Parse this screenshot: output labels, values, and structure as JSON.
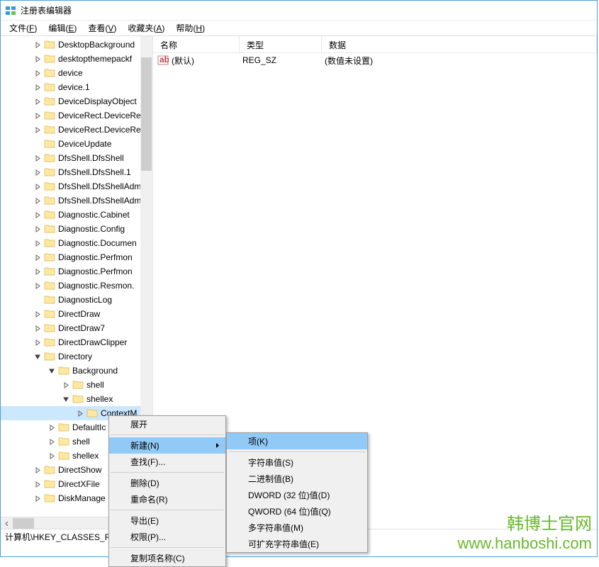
{
  "window": {
    "title": "注册表编辑器"
  },
  "menubar": [
    {
      "label": "文件",
      "accel": "F"
    },
    {
      "label": "编辑",
      "accel": "E"
    },
    {
      "label": "查看",
      "accel": "V"
    },
    {
      "label": "收藏夹",
      "accel": "A"
    },
    {
      "label": "帮助",
      "accel": "H"
    }
  ],
  "tree": [
    {
      "indent": 46,
      "exp": ">",
      "label": "DesktopBackground"
    },
    {
      "indent": 46,
      "exp": ">",
      "label": "desktopthemepackf"
    },
    {
      "indent": 46,
      "exp": ">",
      "label": "device"
    },
    {
      "indent": 46,
      "exp": ">",
      "label": "device.1"
    },
    {
      "indent": 46,
      "exp": ">",
      "label": "DeviceDisplayObject"
    },
    {
      "indent": 46,
      "exp": ">",
      "label": "DeviceRect.DeviceRe"
    },
    {
      "indent": 46,
      "exp": ">",
      "label": "DeviceRect.DeviceRe"
    },
    {
      "indent": 46,
      "exp": "",
      "label": "DeviceUpdate"
    },
    {
      "indent": 46,
      "exp": ">",
      "label": "DfsShell.DfsShell"
    },
    {
      "indent": 46,
      "exp": ">",
      "label": "DfsShell.DfsShell.1"
    },
    {
      "indent": 46,
      "exp": ">",
      "label": "DfsShell.DfsShellAdm"
    },
    {
      "indent": 46,
      "exp": ">",
      "label": "DfsShell.DfsShellAdm"
    },
    {
      "indent": 46,
      "exp": ">",
      "label": "Diagnostic.Cabinet"
    },
    {
      "indent": 46,
      "exp": ">",
      "label": "Diagnostic.Config"
    },
    {
      "indent": 46,
      "exp": ">",
      "label": "Diagnostic.Documen"
    },
    {
      "indent": 46,
      "exp": ">",
      "label": "Diagnostic.Perfmon"
    },
    {
      "indent": 46,
      "exp": ">",
      "label": "Diagnostic.Perfmon"
    },
    {
      "indent": 46,
      "exp": ">",
      "label": "Diagnostic.Resmon."
    },
    {
      "indent": 46,
      "exp": "",
      "label": "DiagnosticLog"
    },
    {
      "indent": 46,
      "exp": ">",
      "label": "DirectDraw"
    },
    {
      "indent": 46,
      "exp": ">",
      "label": "DirectDraw7"
    },
    {
      "indent": 46,
      "exp": ">",
      "label": "DirectDrawClipper"
    },
    {
      "indent": 46,
      "exp": "v",
      "label": "Directory"
    },
    {
      "indent": 66,
      "exp": "v",
      "label": "Background"
    },
    {
      "indent": 86,
      "exp": ">",
      "label": "shell"
    },
    {
      "indent": 86,
      "exp": "v",
      "label": "shellex"
    },
    {
      "indent": 106,
      "exp": ">",
      "label": "ContextM",
      "selected": true
    },
    {
      "indent": 66,
      "exp": ">",
      "label": "DefaultIc"
    },
    {
      "indent": 66,
      "exp": ">",
      "label": "shell"
    },
    {
      "indent": 66,
      "exp": ">",
      "label": "shellex"
    },
    {
      "indent": 46,
      "exp": ">",
      "label": "DirectShow"
    },
    {
      "indent": 46,
      "exp": ">",
      "label": "DirectXFile"
    },
    {
      "indent": 46,
      "exp": ">",
      "label": "DiskManage"
    }
  ],
  "list": {
    "columns": [
      "名称",
      "类型",
      "数据"
    ],
    "rows": [
      {
        "name": "(默认)",
        "type": "REG_SZ",
        "data": "(数值未设置)"
      }
    ]
  },
  "statusbar": "计算机\\HKEY_CLASSES_RO",
  "context_menu_1": [
    {
      "label": "展开",
      "type": "item"
    },
    {
      "type": "sep"
    },
    {
      "label": "新建(N)",
      "type": "item",
      "highlighted": true,
      "submenu": true
    },
    {
      "label": "查找(F)...",
      "type": "item"
    },
    {
      "type": "sep"
    },
    {
      "label": "删除(D)",
      "type": "item"
    },
    {
      "label": "重命名(R)",
      "type": "item"
    },
    {
      "type": "sep"
    },
    {
      "label": "导出(E)",
      "type": "item"
    },
    {
      "label": "权限(P)...",
      "type": "item"
    },
    {
      "type": "sep"
    },
    {
      "label": "复制项名称(C)",
      "type": "item"
    }
  ],
  "context_menu_2": [
    {
      "label": "项(K)",
      "type": "item",
      "highlighted": true
    },
    {
      "type": "sep"
    },
    {
      "label": "字符串值(S)",
      "type": "item"
    },
    {
      "label": "二进制值(B)",
      "type": "item"
    },
    {
      "label": "DWORD (32 位)值(D)",
      "type": "item"
    },
    {
      "label": "QWORD (64 位)值(Q)",
      "type": "item"
    },
    {
      "label": "多字符串值(M)",
      "type": "item"
    },
    {
      "label": "可扩充字符串值(E)",
      "type": "item"
    }
  ],
  "watermark": {
    "line1": "韩博士官网",
    "line2": "www.hanboshi.com"
  }
}
